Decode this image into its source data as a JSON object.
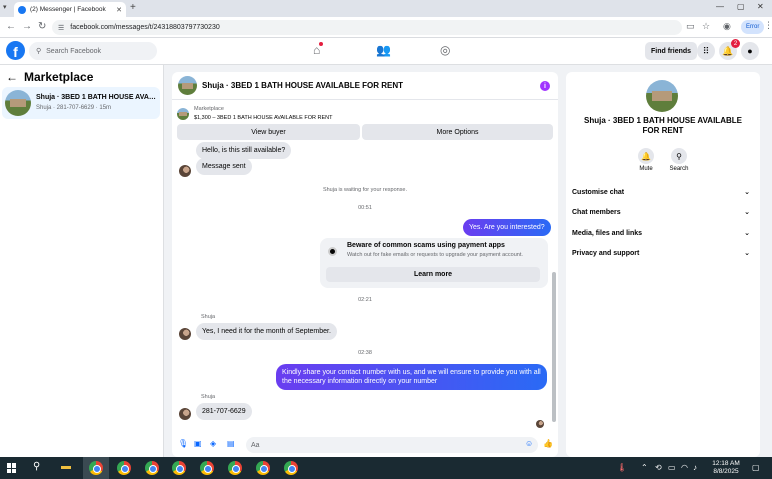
{
  "browser": {
    "tab_title": "(2) Messenger | Facebook",
    "url": "facebook.com/messages/t/24318803797730230",
    "profile_label": "Error",
    "icons": [
      "back-icon",
      "forward-icon",
      "reload-icon",
      "tune-icon",
      "cast-icon",
      "bookmark-star-icon",
      "copilot-icon",
      "kebab-icon"
    ]
  },
  "facebook": {
    "search_placeholder": "Search Facebook",
    "find_friends": "Find friends",
    "notification_count": "2"
  },
  "sidebar": {
    "title": "Marketplace",
    "conversations": [
      {
        "name": "Shuja · 3BED 1 BATH HOUSE AVAILABLE FOR RENT",
        "subtitle": "Shuja · 281-707-6629 · 15m"
      }
    ]
  },
  "chat": {
    "title": "Shuja · 3BED 1 BATH HOUSE AVAILABLE FOR RENT",
    "listing_label": "Marketplace",
    "listing_value": "$1,300 – 3BED 1 BATH HOUSE AVAILABLE FOR RENT",
    "view_buyer": "View buyer",
    "more_options": "More Options",
    "messages": {
      "m1": "Hello, is this still available?",
      "m2": "Message sent",
      "sys_waiting": "Shuja is waiting for your response.",
      "time1": "00:51",
      "m3": "Yes. Are you interested?",
      "warn_title": "Beware of common scams using payment apps",
      "warn_sub": "Watch out for fake emails or requests to upgrade your payment account.",
      "learn_more": "Learn more",
      "time2": "02:21",
      "sender": "Shuja",
      "m4": "Yes, I need it for the month of September.",
      "time3": "02:38",
      "m5": "Kindly share your contact number with us, and we will ensure to provide you with all the necessary information directly on your number",
      "m6": "281-707-6629"
    },
    "composer_placeholder": "Aa"
  },
  "panel": {
    "title": "Shuja · 3BED 1 BATH HOUSE AVAILABLE FOR RENT",
    "mute": "Mute",
    "search": "Search",
    "rows": [
      "Customise chat",
      "Chat members",
      "Media, files and links",
      "Privacy and support"
    ]
  },
  "taskbar": {
    "time": "12:18 AM",
    "date": "8/8/2025"
  },
  "colors": {
    "brand": "#1877f2",
    "sent_bubble": "#6a3df0",
    "received_bubble": "#e4e6eb"
  }
}
